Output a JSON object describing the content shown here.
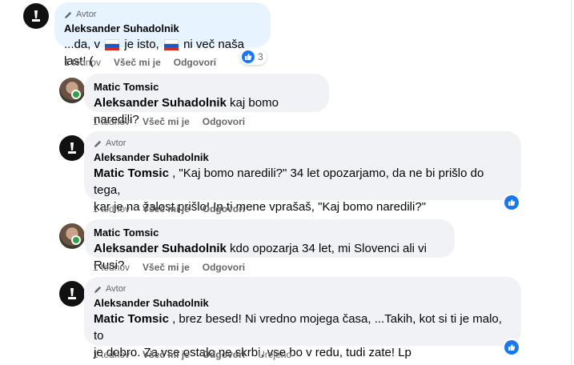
{
  "comments": [
    {
      "badge": "Avtor",
      "author": "Aleksander Suhadolnik",
      "text_before": "...da, v",
      "text_middle": "je isto,",
      "text_after": "ni več naša last! (",
      "time": "1 tednov",
      "like": "Všeč mi je",
      "reply": "Odgovori",
      "reaction_count": "3"
    },
    {
      "author": "Matic Tomsic",
      "mention": "Aleksander Suhadolnik",
      "text": " kaj bomo naredili?",
      "time": "1 tednov",
      "like": "Všeč mi je",
      "reply": "Odgovori"
    },
    {
      "badge": "Avtor",
      "author": "Aleksander Suhadolnik",
      "mention": "Matic Tomsic",
      "line1": " , \"Kaj bomo naredili?\" 34 let opozarjamo, da ne bi prišlo do tega,",
      "line2": "kar je na žalost prišlo! In ti mene vprašaš, \"Kaj bomo naredili?\"",
      "time": "1 tednov",
      "like": "Všeč mi je",
      "reply": "Odgovori"
    },
    {
      "author": "Matic Tomsic",
      "mention": "Aleksander Suhadolnik",
      "text": " kdo opozarja 34 let, mi Slovenci ali vi Rusi?",
      "time": "1 tednov",
      "like": "Všeč mi je",
      "reply": "Odgovori"
    },
    {
      "badge": "Avtor",
      "author": "Aleksander Suhadolnik",
      "mention": "Matic Tomsic",
      "line1": " , brez besed! Ni vredno mojega časa, ...Takih, kot si ti je malo, to",
      "line2": "je dobro. Za vse ostalo ne skrbi, vse bo v redu, tudi zate! Lp",
      "time": "1 tednov",
      "like": "Všeč mi je",
      "reply": "Odgovori",
      "edited": "Urejeno"
    }
  ],
  "colors": {
    "like_blue": "#1877f2",
    "author_bubble": "#e7f3ff",
    "bubble": "#f0f2f5",
    "online": "#31a24c"
  }
}
